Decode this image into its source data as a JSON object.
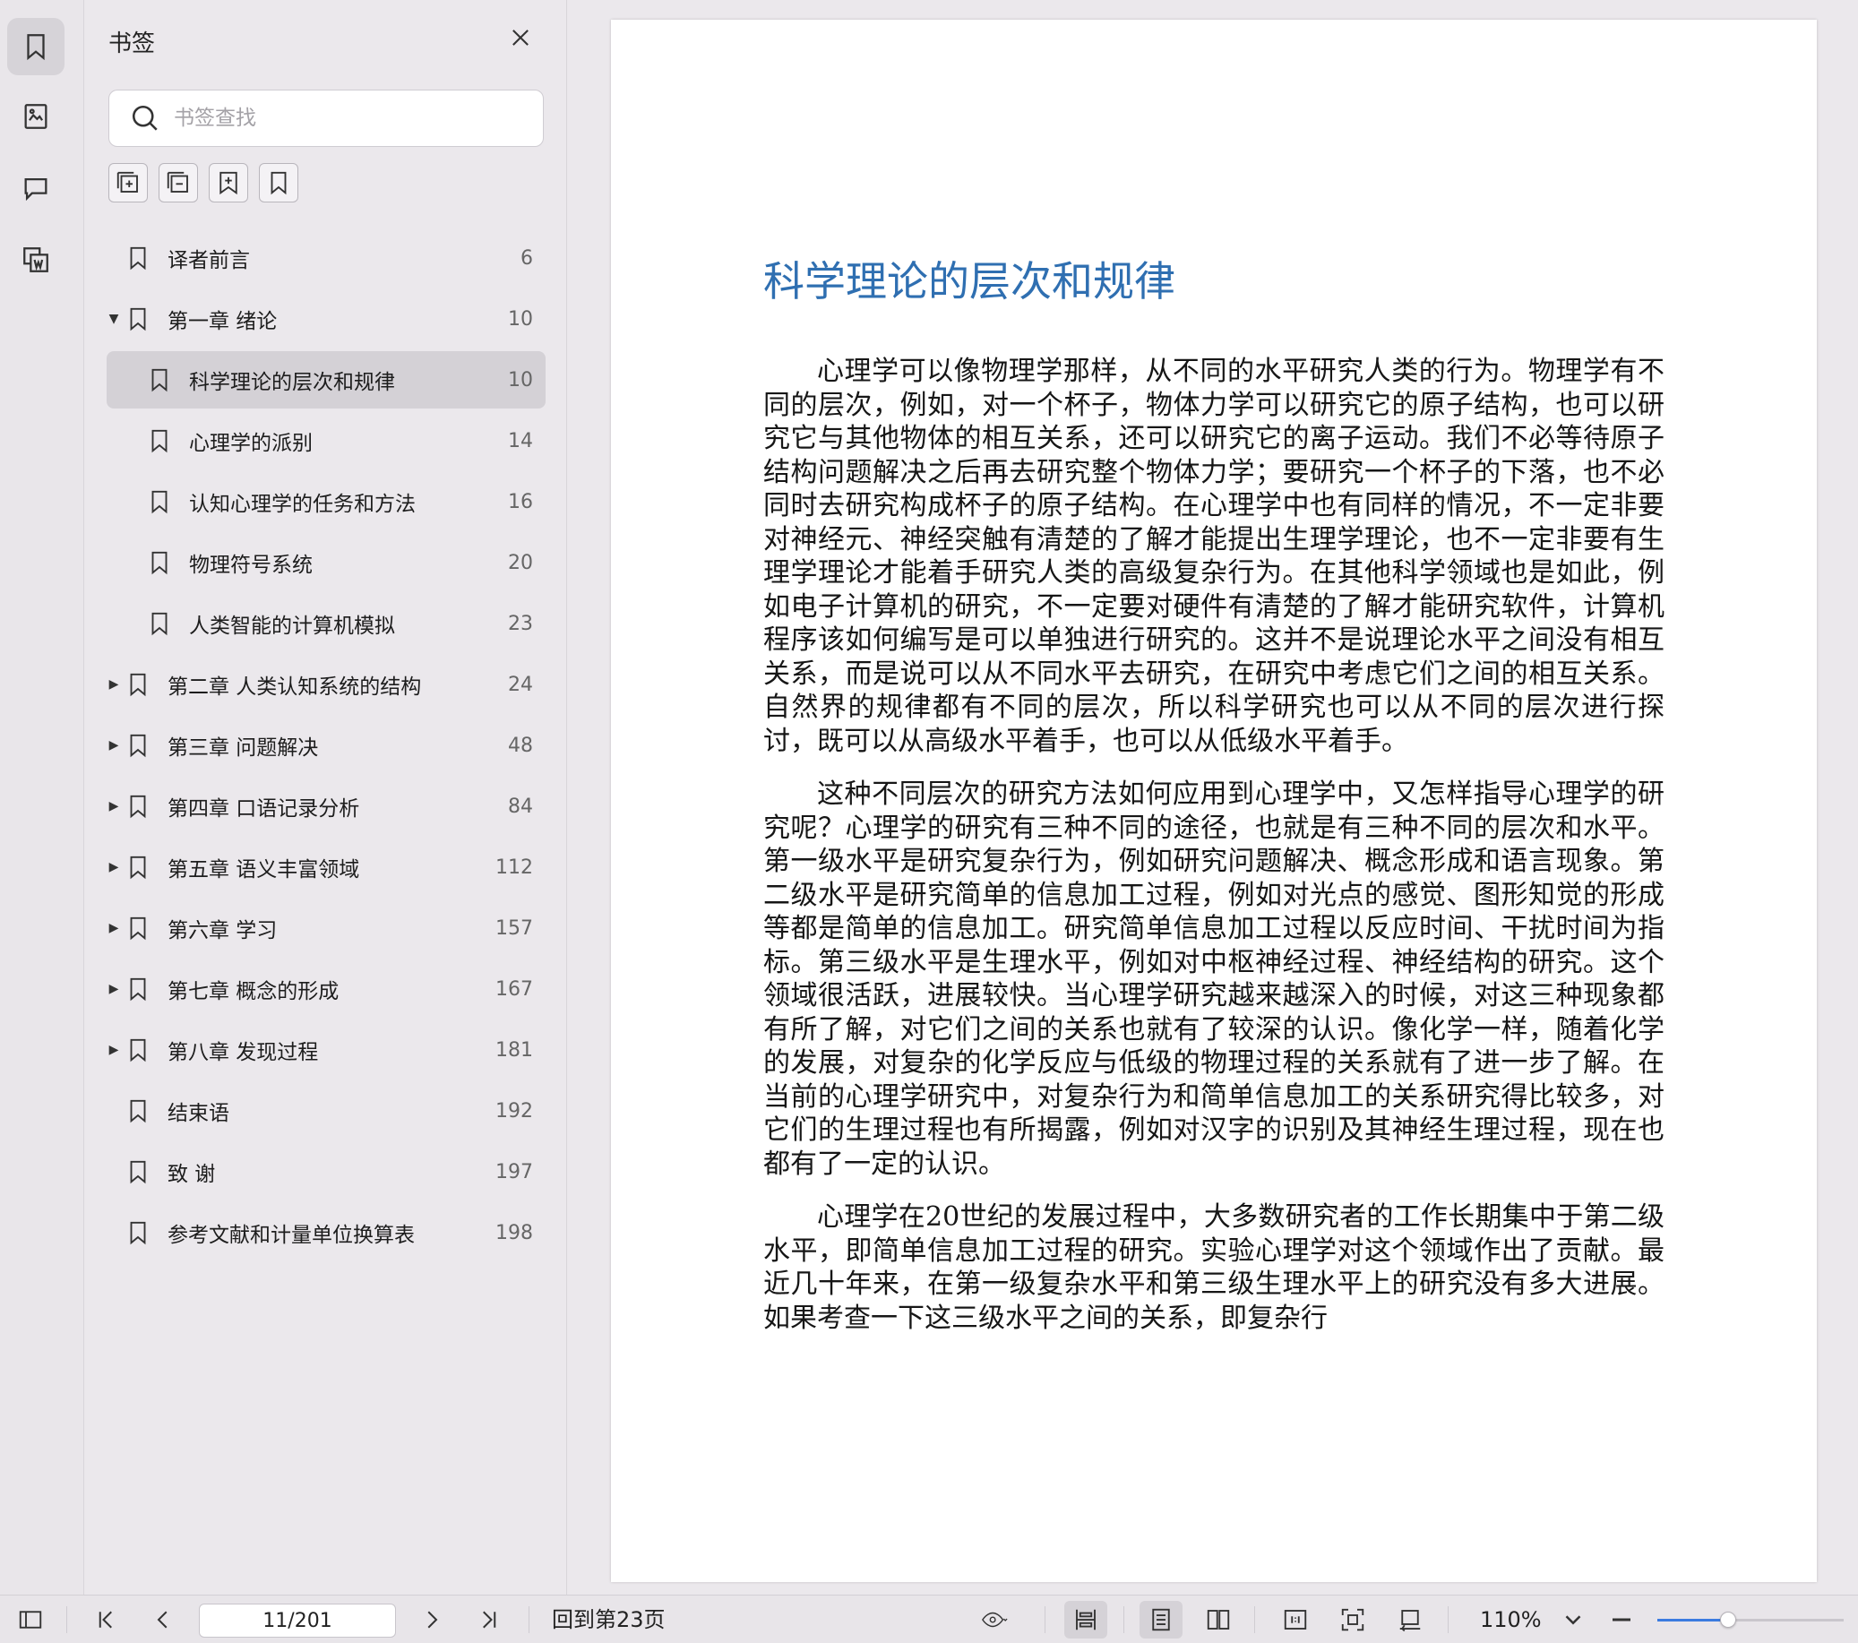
{
  "sidebar": {
    "title": "书签",
    "search_placeholder": "书签查找",
    "rail": [
      "bookmark-icon",
      "thumbnail-icon",
      "comment-icon",
      "attachment-icon"
    ],
    "tools": [
      "expand-all-icon",
      "collapse-all-icon",
      "add-bookmark-icon",
      "bookmark-outline-icon"
    ],
    "bookmarks": [
      {
        "label": "译者前言",
        "page": "6",
        "level": 1,
        "arrow": ""
      },
      {
        "label": "第一章  绪论",
        "page": "10",
        "level": 1,
        "arrow": "▼"
      },
      {
        "label": "科学理论的层次和规律",
        "page": "10",
        "level": 2,
        "arrow": "",
        "selected": true
      },
      {
        "label": "心理学的派别",
        "page": "14",
        "level": 2,
        "arrow": ""
      },
      {
        "label": "认知心理学的任务和方法",
        "page": "16",
        "level": 2,
        "arrow": ""
      },
      {
        "label": "物理符号系统",
        "page": "20",
        "level": 2,
        "arrow": ""
      },
      {
        "label": "人类智能的计算机模拟",
        "page": "23",
        "level": 2,
        "arrow": ""
      },
      {
        "label": "第二章  人类认知系统的结构",
        "page": "24",
        "level": 1,
        "arrow": "▶"
      },
      {
        "label": "第三章  问题解决",
        "page": "48",
        "level": 1,
        "arrow": "▶"
      },
      {
        "label": "第四章  口语记录分析",
        "page": "84",
        "level": 1,
        "arrow": "▶"
      },
      {
        "label": "第五章  语义丰富领域",
        "page": "112",
        "level": 1,
        "arrow": "▶"
      },
      {
        "label": "第六章  学习",
        "page": "157",
        "level": 1,
        "arrow": "▶"
      },
      {
        "label": "第七章  概念的形成",
        "page": "167",
        "level": 1,
        "arrow": "▶"
      },
      {
        "label": "第八章  发现过程",
        "page": "181",
        "level": 1,
        "arrow": "▶"
      },
      {
        "label": "结束语",
        "page": "192",
        "level": 1,
        "arrow": ""
      },
      {
        "label": "致    谢",
        "page": "197",
        "level": 1,
        "arrow": ""
      },
      {
        "label": "参考文献和计量单位换算表",
        "page": "198",
        "level": 1,
        "arrow": ""
      }
    ]
  },
  "document": {
    "title": "科学理论的层次和规律",
    "paragraphs": [
      "心理学可以像物理学那样，从不同的水平研究人类的行为。物理学有不同的层次，例如，对一个杯子，物体力学可以研究它的原子结构，也可以研究它与其他物体的相互关系，还可以研究它的离子运动。我们不必等待原子结构问题解决之后再去研究整个物体力学；要研究一个杯子的下落，也不必同时去研究构成杯子的原子结构。在心理学中也有同样的情况，不一定非要对神经元、神经突触有清楚的了解才能提出生理学理论，也不一定非要有生理学理论才能着手研究人类的高级复杂行为。在其他科学领域也是如此，例如电子计算机的研究，不一定要对硬件有清楚的了解才能研究软件，计算机程序该如何编写是可以单独进行研究的。这并不是说理论水平之间没有相互关系，而是说可以从不同水平去研究，在研究中考虑它们之间的相互关系。自然界的规律都有不同的层次，所以科学研究也可以从不同的层次进行探讨，既可以从高级水平着手，也可以从低级水平着手。",
      "这种不同层次的研究方法如何应用到心理学中，又怎样指导心理学的研究呢？心理学的研究有三种不同的途径，也就是有三种不同的层次和水平。第一级水平是研究复杂行为，例如研究问题解决、概念形成和语言现象。第二级水平是研究简单的信息加工过程，例如对光点的感觉、图形知觉的形成等都是简单的信息加工。研究简单信息加工过程以反应时间、干扰时间为指标。第三级水平是生理水平，例如对中枢神经过程、神经结构的研究。这个领域很活跃，进展较快。当心理学研究越来越深入的时候，对这三种现象都有所了解，对它们之间的关系也就有了较深的认识。像化学一样，随着化学的发展，对复杂的化学反应与低级的物理过程的关系就有了进一步了解。在当前的心理学研究中，对复杂行为和简单信息加工的关系研究得比较多，对它们的生理过程也有所揭露，例如对汉字的识别及其神经生理过程，现在也都有了一定的认识。",
      "心理学在20世纪的发展过程中，大多数研究者的工作长期集中于第二级水平，即简单信息加工过程的研究。实验心理学对这个领域作出了贡献。最近几十年来，在第一级复杂水平和第三级生理水平上的研究没有多大进展。如果考查一下这三级水平之间的关系，即复杂行"
    ]
  },
  "statusbar": {
    "page_value": "11/201",
    "goto_label": "回到第23页",
    "zoom_label": "110%",
    "zoom_fraction": 0.38
  }
}
